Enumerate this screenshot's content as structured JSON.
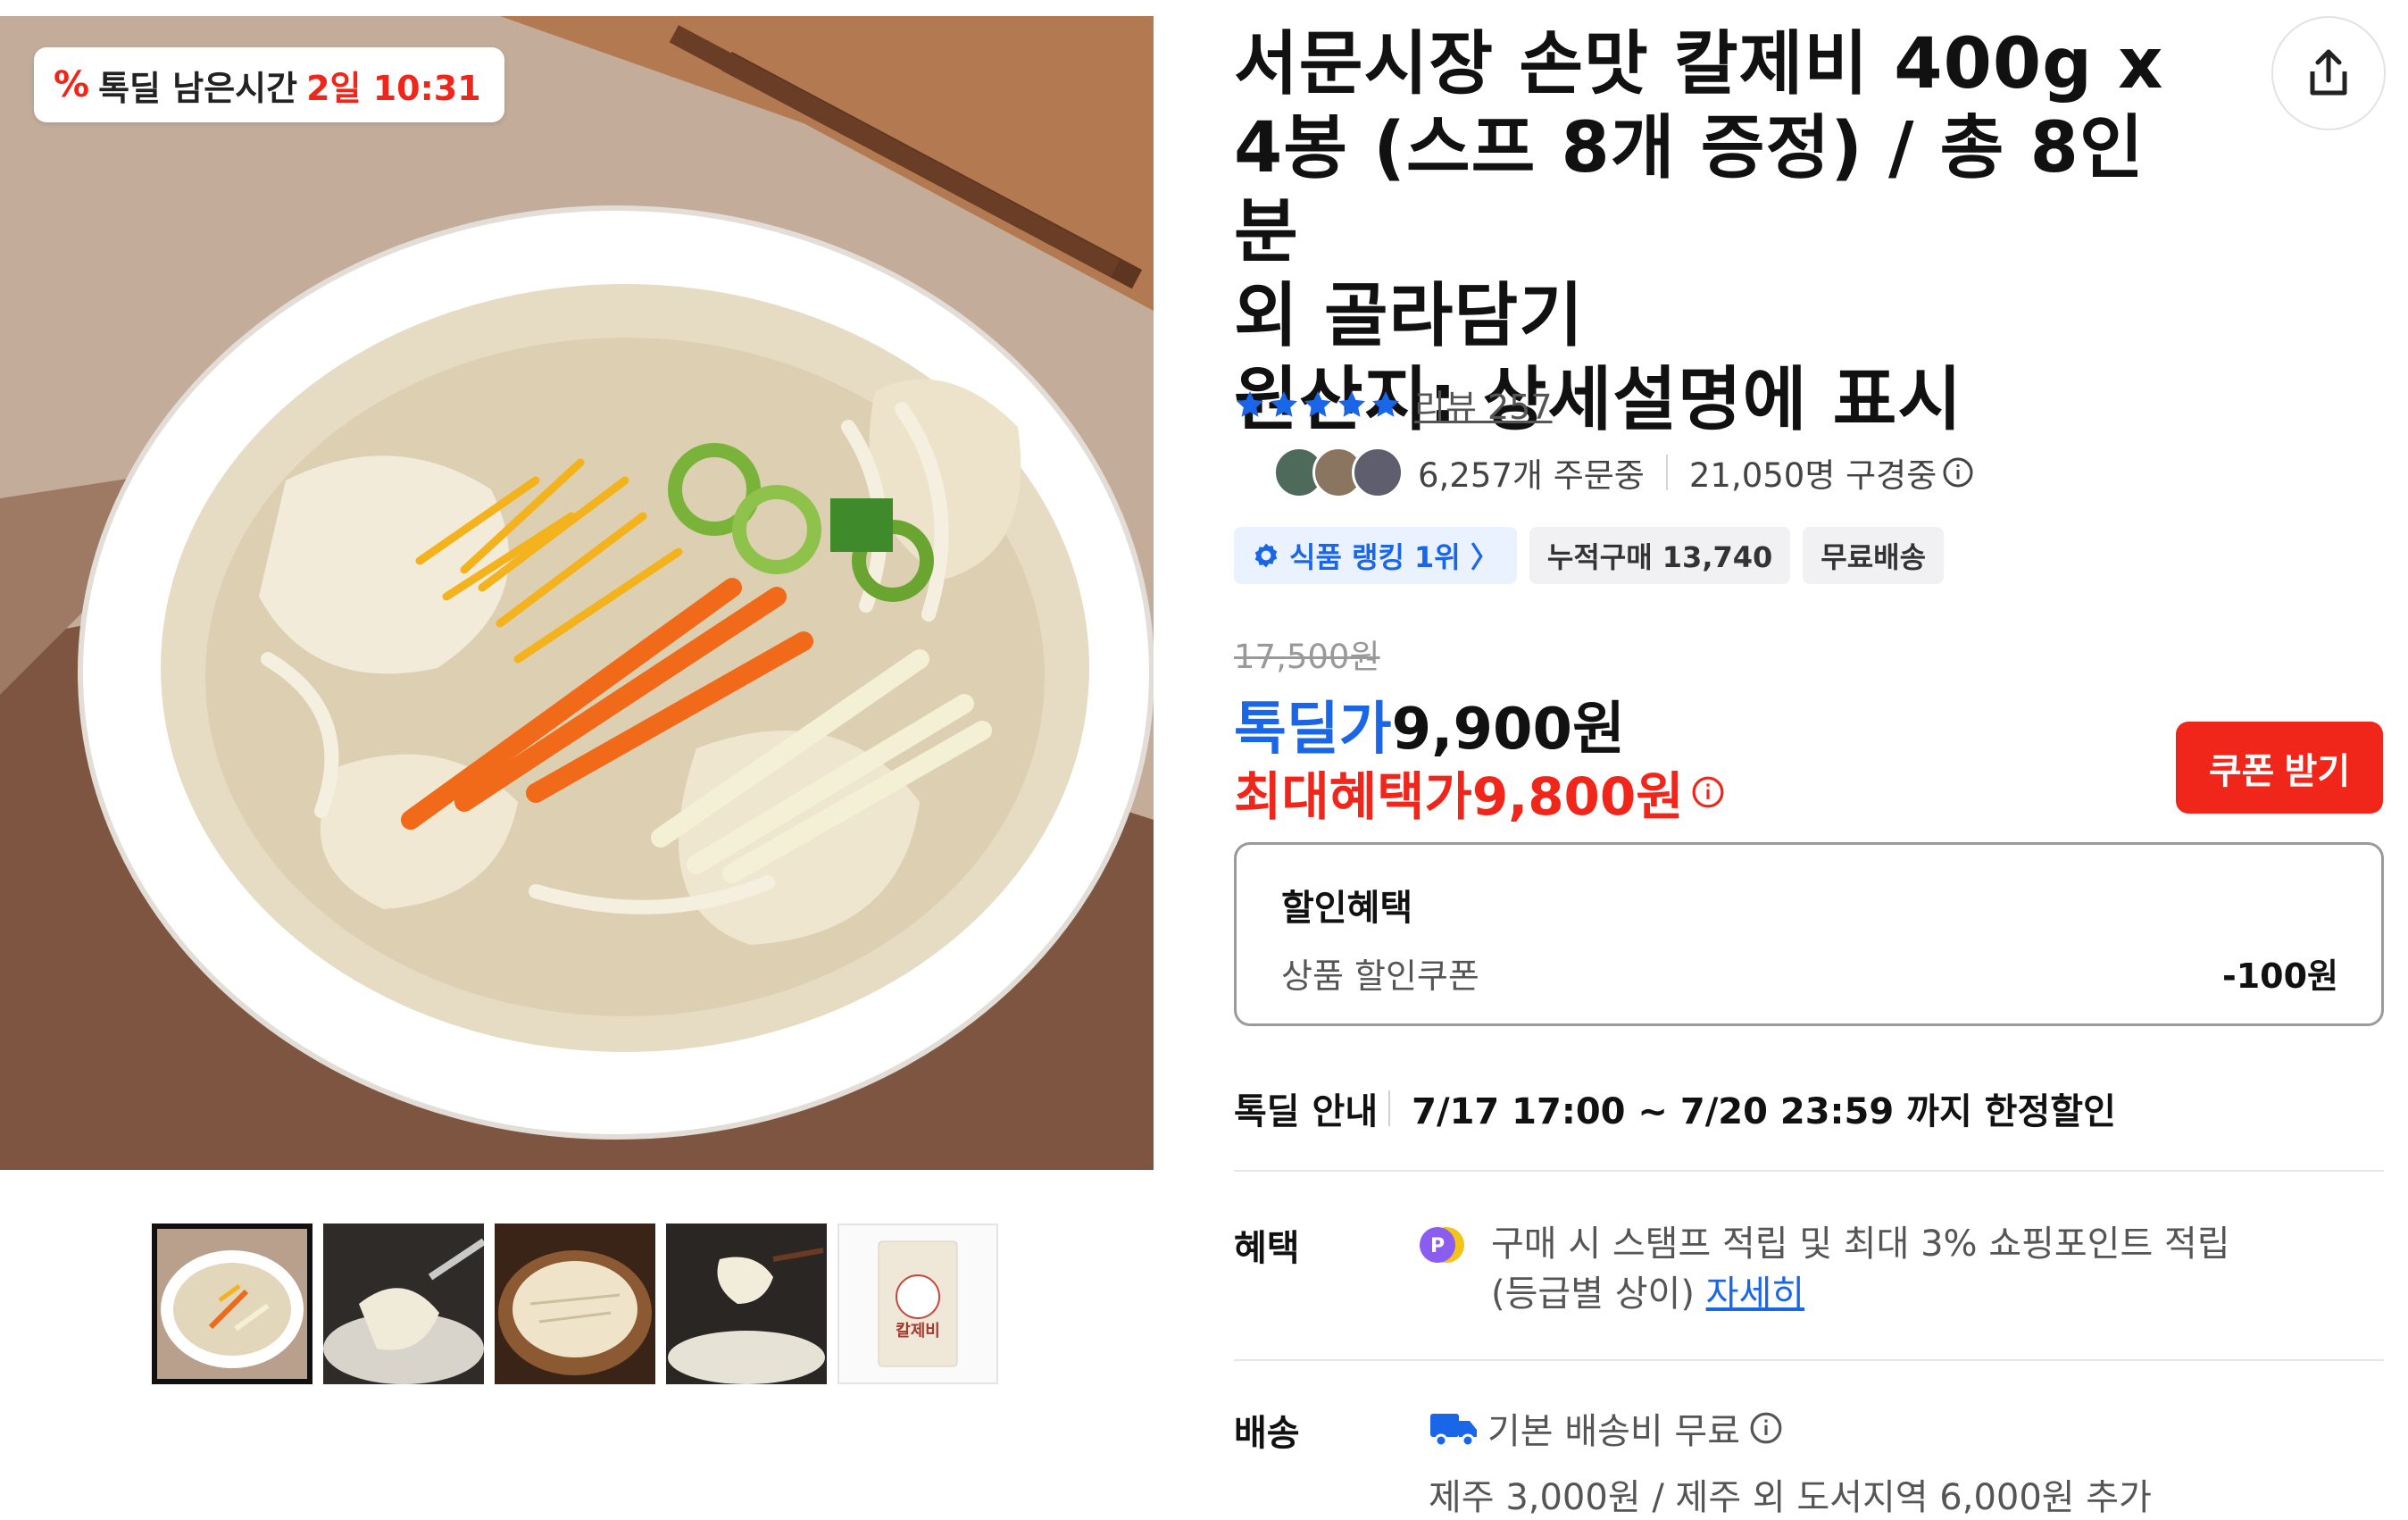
{
  "deal_timer": {
    "icon": "percent-icon",
    "label": "톡딜 남은시간",
    "time": "2일 10:31"
  },
  "product": {
    "title": "서문시장 손맛 칼제비 400g x\n4봉 (스프 8개 증정) / 총 8인분\n외 골라담기\n원산지: 상세설명에 표시",
    "rating_stars": 5,
    "review_link": "리뷰 257"
  },
  "buyers": {
    "ordering": "6,257개 주문중",
    "viewing": "21,050명 구경중"
  },
  "badges": [
    {
      "label": "식품 랭킹 1위 〉",
      "type": "rank"
    },
    {
      "label": "누적구매 13,740",
      "type": "plain"
    },
    {
      "label": "무료배송",
      "type": "plain"
    }
  ],
  "price": {
    "original": "17,500원",
    "deal_label": "톡딜가",
    "deal_value": "9,900원",
    "max_label": "최대혜택가",
    "max_value": "9,800원",
    "coupon_button": "쿠폰 받기"
  },
  "discount": {
    "header": "할인혜택",
    "item_label": "상품 할인쿠폰",
    "item_value": "-100원"
  },
  "deal_info": {
    "label": "톡딜 안내",
    "text": "7/17 17:00 ~ 7/20 23:59 까지 한정할인"
  },
  "benefit": {
    "label": "혜택",
    "text": "구매 시 스탬프 적립 및 최대 3% 쇼핑포인트 적립\n(등급별 상이) ",
    "link": "자세히"
  },
  "shipping": {
    "label": "배송",
    "line1": "기본 배송비 무료",
    "line2": "제주 3,000원 / 제주 외 도서지역 6,000원 추가"
  },
  "thumbnail_label": "칼제비",
  "colors": {
    "accent_red": "#f0261b",
    "accent_blue": "#1a66e8",
    "star": "#1a66e8",
    "point_purple": "#8a5cf0"
  }
}
